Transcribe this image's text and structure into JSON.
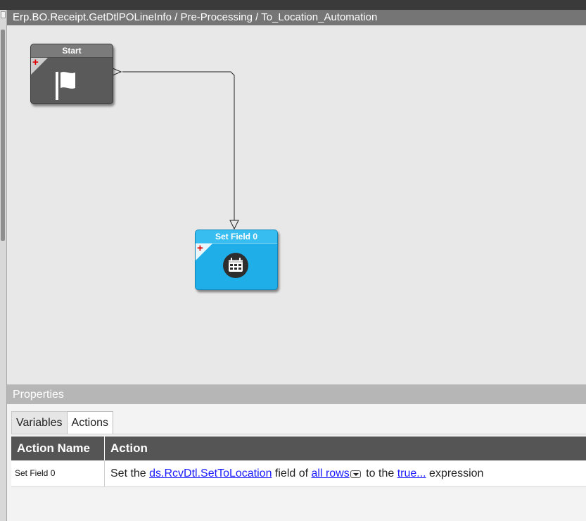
{
  "breadcrumb": "Erp.BO.Receipt.GetDtlPOLineInfo / Pre-Processing / To_Location_Automation",
  "nodes": {
    "start": {
      "title": "Start",
      "icon": "flag-icon",
      "color": "#5a5a5a"
    },
    "set_field": {
      "title": "Set Field 0",
      "icon": "calendar-icon",
      "color": "#1faee8"
    }
  },
  "properties": {
    "title": "Properties",
    "tabs": [
      "Variables",
      "Actions"
    ],
    "active_tab": "Actions",
    "columns": [
      "Action Name",
      "Action"
    ],
    "rows": [
      {
        "name": "Set Field 0",
        "action": {
          "p1": "Set the",
          "field": "ds.RcvDtl.SetToLocation",
          "p2": "field of",
          "rows": "all rows",
          "p3": "to the",
          "expr": "true...",
          "p4": "expression"
        }
      }
    ]
  }
}
